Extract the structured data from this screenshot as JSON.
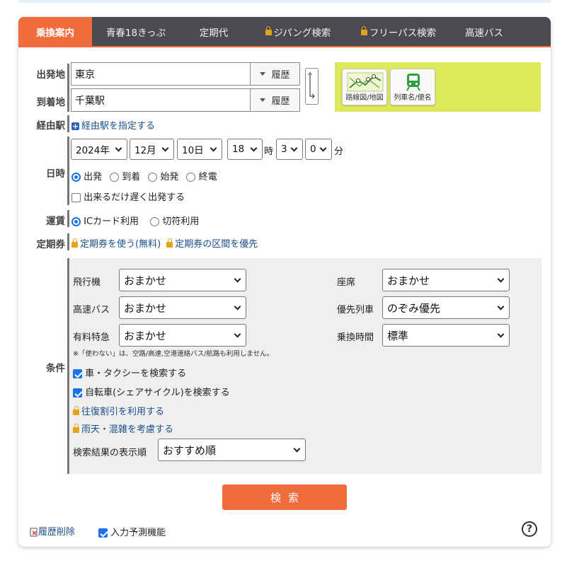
{
  "tabs": [
    {
      "label": "乗換案内",
      "active": true,
      "locked": false
    },
    {
      "label": "青春18きっぷ",
      "active": false,
      "locked": false
    },
    {
      "label": "定期代",
      "active": false,
      "locked": false
    },
    {
      "label": "ジパング検索",
      "active": false,
      "locked": true
    },
    {
      "label": "フリーパス検索",
      "active": false,
      "locked": true
    },
    {
      "label": "高速バス",
      "active": false,
      "locked": false
    }
  ],
  "labels": {
    "departure": "出発地",
    "arrival": "到着地",
    "via": "経由駅",
    "datetime": "日時",
    "fare": "運賃",
    "pass": "定期券",
    "conditions": "条件"
  },
  "departure": {
    "value": "東京",
    "history": "履歴"
  },
  "arrival": {
    "value": "千葉駅",
    "history": "履歴"
  },
  "tools": {
    "route_map": "路線図/地図",
    "train_name": "列車名/便名"
  },
  "via_link": "経由駅を指定する",
  "date": {
    "year": "2024年",
    "month": "12月",
    "day": "10日",
    "hour": "18",
    "hour_unit": "時",
    "min_tens": "3",
    "min_ones": "0",
    "min_unit": "分"
  },
  "time_types": [
    {
      "label": "出発",
      "checked": true
    },
    {
      "label": "到着",
      "checked": false
    },
    {
      "label": "始発",
      "checked": false
    },
    {
      "label": "終電",
      "checked": false
    }
  ],
  "late_departure": {
    "label": "出来るだけ遅く出発する",
    "checked": false
  },
  "fare_types": [
    {
      "label": "ICカード利用",
      "checked": true
    },
    {
      "label": "切符利用",
      "checked": false
    }
  ],
  "pass_links": [
    "定期券を使う(無料)",
    "定期券の区間を優先"
  ],
  "conditions": {
    "airplane": {
      "label": "飛行機",
      "value": "おまかせ"
    },
    "highway_bus": {
      "label": "高速バス",
      "value": "おまかせ"
    },
    "express": {
      "label": "有料特急",
      "value": "おまかせ"
    },
    "seat": {
      "label": "座席",
      "value": "おまかせ"
    },
    "priority_train": {
      "label": "優先列車",
      "value": "のぞみ優先"
    },
    "transfer_time": {
      "label": "乗換時間",
      "value": "標準"
    },
    "note": "※「使わない」は、空路/高速,空港連絡バス/航路も利用しません。",
    "car_taxi": {
      "label": "車・タクシーを検索する",
      "checked": true
    },
    "bicycle": {
      "label": "自転車(シェアサイクル)を検索する",
      "checked": true
    },
    "round_trip": "往復割引を利用する",
    "weather": "雨天・混雑を考慮する",
    "sort": {
      "label": "検索結果の表示順",
      "value": "おすすめ順"
    }
  },
  "search_button": "検索",
  "footer": {
    "clear_history": "履歴削除",
    "predict": {
      "label": "入力予測機能",
      "checked": true
    },
    "help": "?"
  },
  "colors": {
    "accent": "#f26b3a",
    "tabbar": "#4a4a4f",
    "tools_bg": "#dde85a",
    "link": "#1a4e8c"
  }
}
